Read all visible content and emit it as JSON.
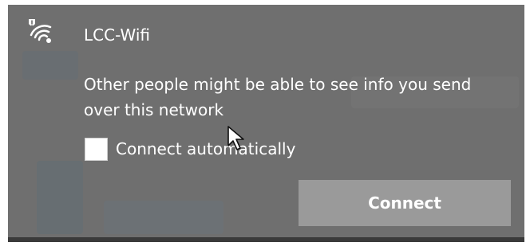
{
  "network": {
    "name": "LCC-Wifi",
    "icon": "wifi-warning-icon",
    "warning_text": "Other people might be able to see info you send over this network",
    "connect_automatically": {
      "label": "Connect automatically",
      "checked": false
    },
    "connect_button_label": "Connect"
  },
  "colors": {
    "panel_background": "#6f6f6f",
    "button_background": "#9a9a9a",
    "text": "#ffffff",
    "checkbox": "#ffffff",
    "bottom_bar": "#3a3a3a"
  }
}
